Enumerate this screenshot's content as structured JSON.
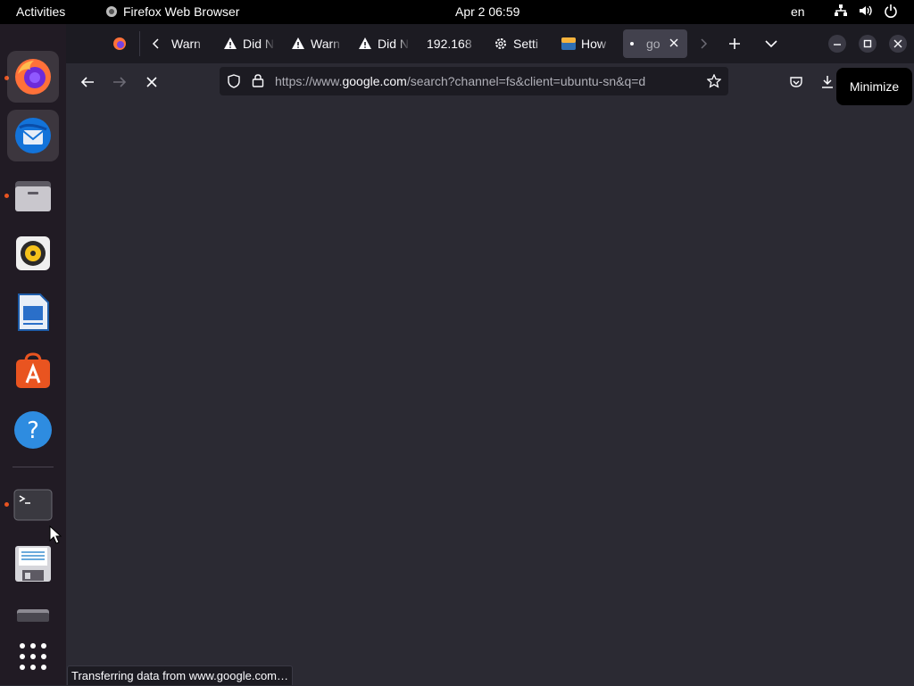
{
  "topbar": {
    "activities": "Activities",
    "app_name": "Firefox Web Browser",
    "clock": "Apr 2  06:59",
    "lang": "en",
    "icons": [
      "network-icon",
      "volume-icon",
      "power-icon"
    ]
  },
  "dock": {
    "apps": [
      "firefox",
      "thunderbird",
      "files",
      "rhythmbox",
      "libreoffice-writer",
      "app-center",
      "help",
      "terminal",
      "save-file",
      "drive"
    ],
    "running_indicators": [
      "firefox",
      "files",
      "terminal"
    ],
    "show_apps": "show-apps-grid"
  },
  "tabs": [
    {
      "label": "Warn",
      "icon": "warning-icon"
    },
    {
      "label": "Did N",
      "icon": "warning-icon"
    },
    {
      "label": "Warn",
      "icon": "warning-icon"
    },
    {
      "label": "Did N",
      "icon": "warning-icon"
    },
    {
      "label": "192.168",
      "icon": ""
    },
    {
      "label": "Setti",
      "icon": "gear-icon"
    },
    {
      "label": "How",
      "icon": "foss-linux-icon"
    },
    {
      "label": "go",
      "icon": "loading-dot-icon",
      "selected": true
    }
  ],
  "navbar": {
    "url_prefix": "https://www.",
    "url_host": "google.com",
    "url_path": "/search?channel=fs&client=ubuntu-sn&q=d"
  },
  "tooltip": "Minimize",
  "status": "Transferring data from www.google.com…",
  "colors": {
    "accent": "#e95420",
    "chrome": "#1c1b22",
    "content": "#2b2a33"
  }
}
